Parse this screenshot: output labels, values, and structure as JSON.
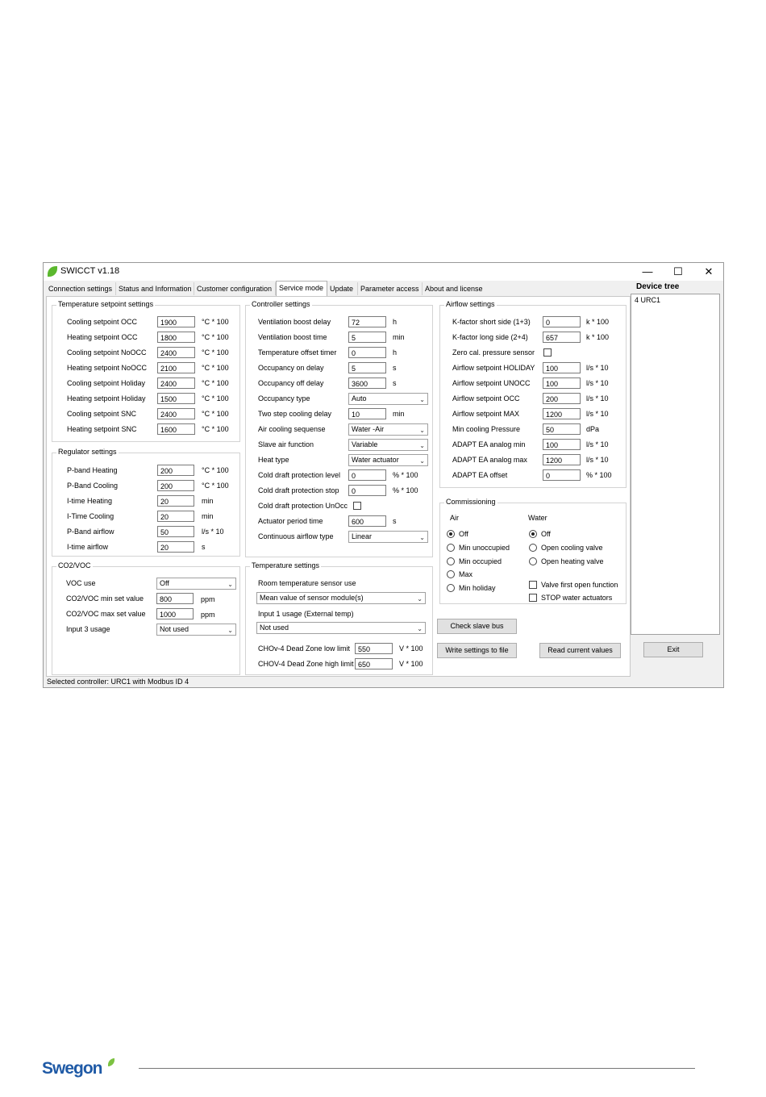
{
  "window": {
    "title": "SWICCT v1.18",
    "minimize": "—",
    "maximize": "☐",
    "close": "✕"
  },
  "tabs": [
    "Connection settings",
    "Status and Information",
    "Customer configuration",
    "Service mode",
    "Update",
    "Parameter access",
    "About and license"
  ],
  "temp_setpoint": {
    "title": "Temperature setpoint settings",
    "rows": [
      {
        "label": "Cooling setpoint OCC",
        "value": "1900",
        "unit": "°C * 100"
      },
      {
        "label": "Heating setpoint OCC",
        "value": "1800",
        "unit": "°C * 100"
      },
      {
        "label": "Cooling setpoint NoOCC",
        "value": "2400",
        "unit": "°C * 100"
      },
      {
        "label": "Heating setpoint NoOCC",
        "value": "2100",
        "unit": "°C * 100"
      },
      {
        "label": "Cooling setpoint Holiday",
        "value": "2400",
        "unit": "°C * 100"
      },
      {
        "label": "Heating setpoint Holiday",
        "value": "1500",
        "unit": "°C * 100"
      },
      {
        "label": "Cooling setpoint SNC",
        "value": "2400",
        "unit": "°C * 100"
      },
      {
        "label": "Heating setpoint SNC",
        "value": "1600",
        "unit": "°C * 100"
      }
    ]
  },
  "regulator": {
    "title": "Regulator settings",
    "rows": [
      {
        "label": "P-band Heating",
        "value": "200",
        "unit": "°C * 100"
      },
      {
        "label": "P-Band Cooling",
        "value": "200",
        "unit": "°C * 100"
      },
      {
        "label": "I-time Heating",
        "value": "20",
        "unit": "min"
      },
      {
        "label": "I-Time Cooling",
        "value": "20",
        "unit": "min"
      },
      {
        "label": "P-Band airflow",
        "value": "50",
        "unit": "l/s * 10"
      },
      {
        "label": "I-time airflow",
        "value": "20",
        "unit": "s"
      }
    ]
  },
  "co2": {
    "title": "CO2/VOC",
    "voc_use_label": "VOC use",
    "voc_use_value": "Off",
    "min_label": "CO2/VOC min set value",
    "min_value": "800",
    "min_unit": "ppm",
    "max_label": "CO2/VOC max set value",
    "max_value": "1000",
    "max_unit": "ppm",
    "input3_label": "Input 3 usage",
    "input3_value": "Not used"
  },
  "controller": {
    "title": "Controller settings",
    "boost_delay": {
      "label": "Ventilation boost delay",
      "value": "72",
      "unit": "h"
    },
    "boost_time": {
      "label": "Ventilation boost time",
      "value": "5",
      "unit": "min"
    },
    "offset_timer": {
      "label": "Temperature offset timer",
      "value": "0",
      "unit": "h"
    },
    "occ_on": {
      "label": "Occupancy on delay",
      "value": "5",
      "unit": "s"
    },
    "occ_off": {
      "label": "Occupancy off delay",
      "value": "3600",
      "unit": "s"
    },
    "occ_type": {
      "label": "Occupancy type",
      "value": "Auto"
    },
    "two_step": {
      "label": "Two step cooling delay",
      "value": "10",
      "unit": "min"
    },
    "air_cooling": {
      "label": "Air cooling sequense",
      "value": "Water -Air"
    },
    "slave_air": {
      "label": "Slave air function",
      "value": "Variable"
    },
    "heat_type": {
      "label": "Heat type",
      "value": "Water actuator"
    },
    "cold_level": {
      "label": "Cold draft protection level",
      "value": "0",
      "unit": "% * 100"
    },
    "cold_stop": {
      "label": "Cold draft protection stop",
      "value": "0",
      "unit": "% * 100"
    },
    "cold_unocc": {
      "label": "Cold draft protection UnOcc"
    },
    "actuator": {
      "label": "Actuator period time",
      "value": "600",
      "unit": "s"
    },
    "cont_airflow": {
      "label": "Continuous airflow type",
      "value": "Linear"
    }
  },
  "temp_settings": {
    "title": "Temperature settings",
    "room_label": "Room temperature sensor use",
    "room_value": "Mean value of sensor module(s)",
    "input1_label": "Input 1 usage (External temp)",
    "input1_value": "Not used",
    "dz_low": {
      "label": "CHOv-4 Dead Zone low limit",
      "value": "550",
      "unit": "V * 100"
    },
    "dz_high": {
      "label": "CHOV-4 Dead Zone high limit",
      "value": "650",
      "unit": "V * 100"
    }
  },
  "airflow": {
    "title": "Airflow settings",
    "k_short": {
      "label": "K-factor short side (1+3)",
      "value": "0",
      "unit": "k * 100"
    },
    "k_long": {
      "label": "K-factor long side (2+4)",
      "value": "657",
      "unit": "k * 100"
    },
    "zero_cal": {
      "label": "Zero cal. pressure sensor"
    },
    "holiday": {
      "label": "Airflow setpoint HOLIDAY",
      "value": "100",
      "unit": "l/s * 10"
    },
    "unocc": {
      "label": "Airflow setpoint UNOCC",
      "value": "100",
      "unit": "l/s * 10"
    },
    "occ": {
      "label": "Airflow setpoint OCC",
      "value": "200",
      "unit": "l/s * 10"
    },
    "max": {
      "label": "Airflow setpoint MAX",
      "value": "1200",
      "unit": "l/s * 10"
    },
    "min_cool": {
      "label": "Min cooling Pressure",
      "value": "50",
      "unit": "dPa"
    },
    "ea_min": {
      "label": "ADAPT EA analog min",
      "value": "100",
      "unit": "l/s * 10"
    },
    "ea_max": {
      "label": "ADAPT EA analog max",
      "value": "1200",
      "unit": "l/s * 10"
    },
    "ea_off": {
      "label": "ADAPT EA offset",
      "value": "0",
      "unit": "% * 100"
    }
  },
  "commissioning": {
    "title": "Commissioning",
    "air_header": "Air",
    "air_options": [
      "Off",
      "Min unoccupied",
      "Min occupied",
      "Max",
      "Min holiday"
    ],
    "water_header": "Water",
    "water_options": [
      "Off",
      "Open cooling valve",
      "Open heating valve"
    ],
    "valve_first": "Valve first open function",
    "stop_water": "STOP water actuators"
  },
  "buttons": {
    "check_slave": "Check slave bus",
    "write_settings": "Write settings to file",
    "read_values": "Read current values",
    "exit": "Exit"
  },
  "device_tree": {
    "title": "Device tree",
    "item": "4 URC1"
  },
  "status": "Selected controller: URC1 with Modbus ID 4",
  "footer": {
    "brand": "Swegon"
  }
}
